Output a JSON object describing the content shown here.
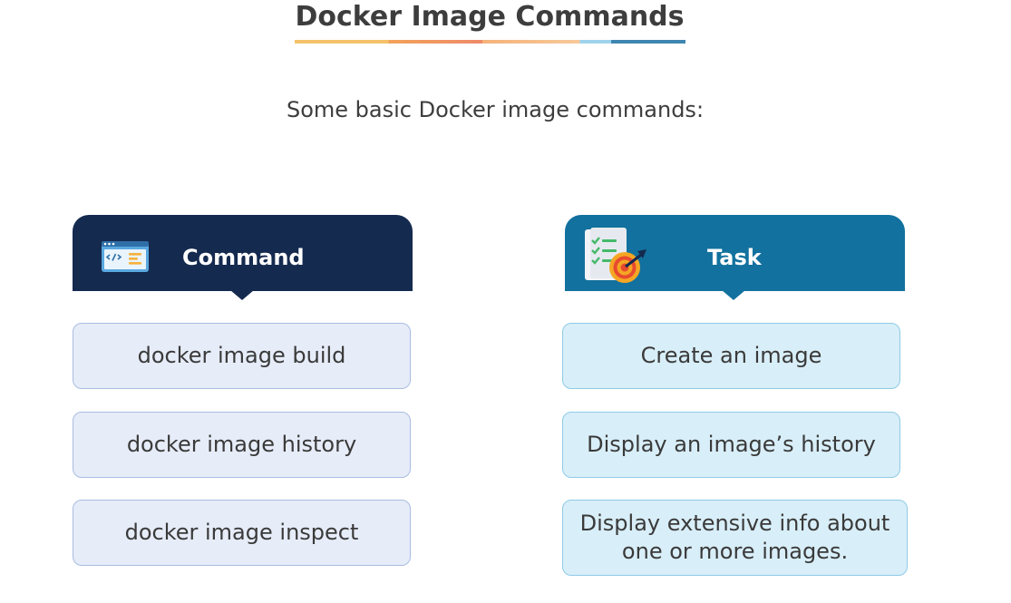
{
  "title": "Docker Image Commands",
  "subtitle": "Some basic Docker image commands:",
  "columns": {
    "command": {
      "header": "Command",
      "icon": "code-window-icon",
      "color": "#152a4f"
    },
    "task": {
      "header": "Task",
      "icon": "checklist-target-icon",
      "color": "#12719e"
    }
  },
  "rows": [
    {
      "command": "docker image build",
      "task": "Create an image"
    },
    {
      "command": "docker image history",
      "task": "Display an image’s history"
    },
    {
      "command": "docker image inspect",
      "task": "Display extensive info about one or more images."
    }
  ]
}
